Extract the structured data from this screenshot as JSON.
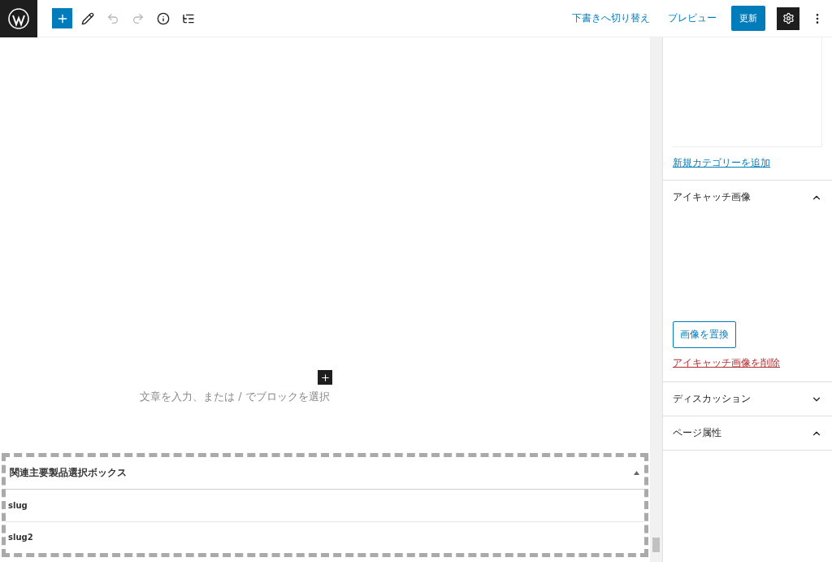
{
  "toolbar": {
    "tools": [
      {
        "kind": "add",
        "disabled": false
      },
      {
        "kind": "edit",
        "disabled": false
      },
      {
        "kind": "undo",
        "disabled": true
      },
      {
        "kind": "redo",
        "disabled": true
      },
      {
        "kind": "info",
        "disabled": false
      },
      {
        "kind": "outline",
        "disabled": false
      }
    ]
  },
  "actions": {
    "switch_to_draft": "下書きへ切り替え",
    "preview": "プレビュー",
    "update": "更新",
    "settings_selected": true
  },
  "editor": {
    "placeholder": "文章を入力、または / でブロックを選択"
  },
  "metabox": {
    "title": "関連主要製品選択ボックス",
    "expanded": true,
    "highlighted": true,
    "fields": [
      "slug",
      "slug2"
    ]
  },
  "sidebar": {
    "add_category_link": "新規カテゴリーを追加",
    "panels": [
      {
        "title": "アイキャッチ画像",
        "expanded": true,
        "replace_button": "画像を置換",
        "remove_link": "アイキャッチ画像を削除"
      },
      {
        "title": "ディスカッション",
        "expanded": false
      },
      {
        "title": "ページ属性",
        "expanded": true
      }
    ]
  }
}
